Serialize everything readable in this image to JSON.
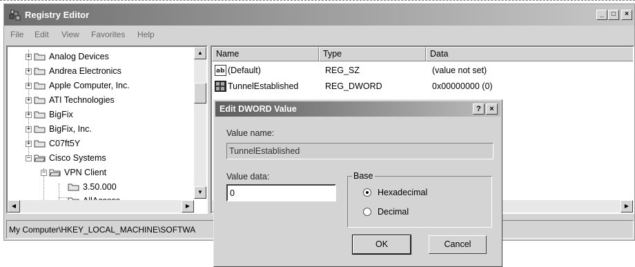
{
  "window": {
    "title": "Registry Editor",
    "controls": {
      "minimize": "_",
      "maximize": "□",
      "close": "×"
    }
  },
  "menu": [
    "File",
    "Edit",
    "View",
    "Favorites",
    "Help"
  ],
  "tree": {
    "items": [
      {
        "label": "Analog Devices",
        "expander": "+"
      },
      {
        "label": "Andrea Electronics",
        "expander": "+"
      },
      {
        "label": "Apple Computer, Inc.",
        "expander": "+"
      },
      {
        "label": "ATI Technologies",
        "expander": "+"
      },
      {
        "label": "BigFix",
        "expander": "+"
      },
      {
        "label": "BigFix, Inc.",
        "expander": "+"
      },
      {
        "label": "C07ft5Y",
        "expander": "+"
      },
      {
        "label": "Cisco Systems",
        "expander": "−"
      },
      {
        "label": "VPN Client",
        "expander": "−"
      },
      {
        "label": "3.50.000",
        "expander": ""
      },
      {
        "label": "AllAccess",
        "expander": ""
      }
    ]
  },
  "list": {
    "columns": [
      "Name",
      "Type",
      "Data"
    ],
    "rows": [
      {
        "icon": "string-value-icon",
        "name": "(Default)",
        "type": "REG_SZ",
        "data": "(value not set)"
      },
      {
        "icon": "binary-value-icon",
        "name": "TunnelEstablished",
        "type": "REG_DWORD",
        "data": "0x00000000 (0)"
      }
    ]
  },
  "status_bar": "My Computer\\HKEY_LOCAL_MACHINE\\SOFTWA",
  "dialog": {
    "title": "Edit DWORD Value",
    "help": "?",
    "close": "×",
    "value_name_label": "Value name:",
    "value_name": "TunnelEstablished",
    "value_data_label": "Value data:",
    "value_data": "0",
    "base_label": "Base",
    "base_options": [
      {
        "label": "Hexadecimal",
        "selected": true
      },
      {
        "label": "Decimal",
        "selected": false
      }
    ],
    "ok": "OK",
    "cancel": "Cancel"
  }
}
